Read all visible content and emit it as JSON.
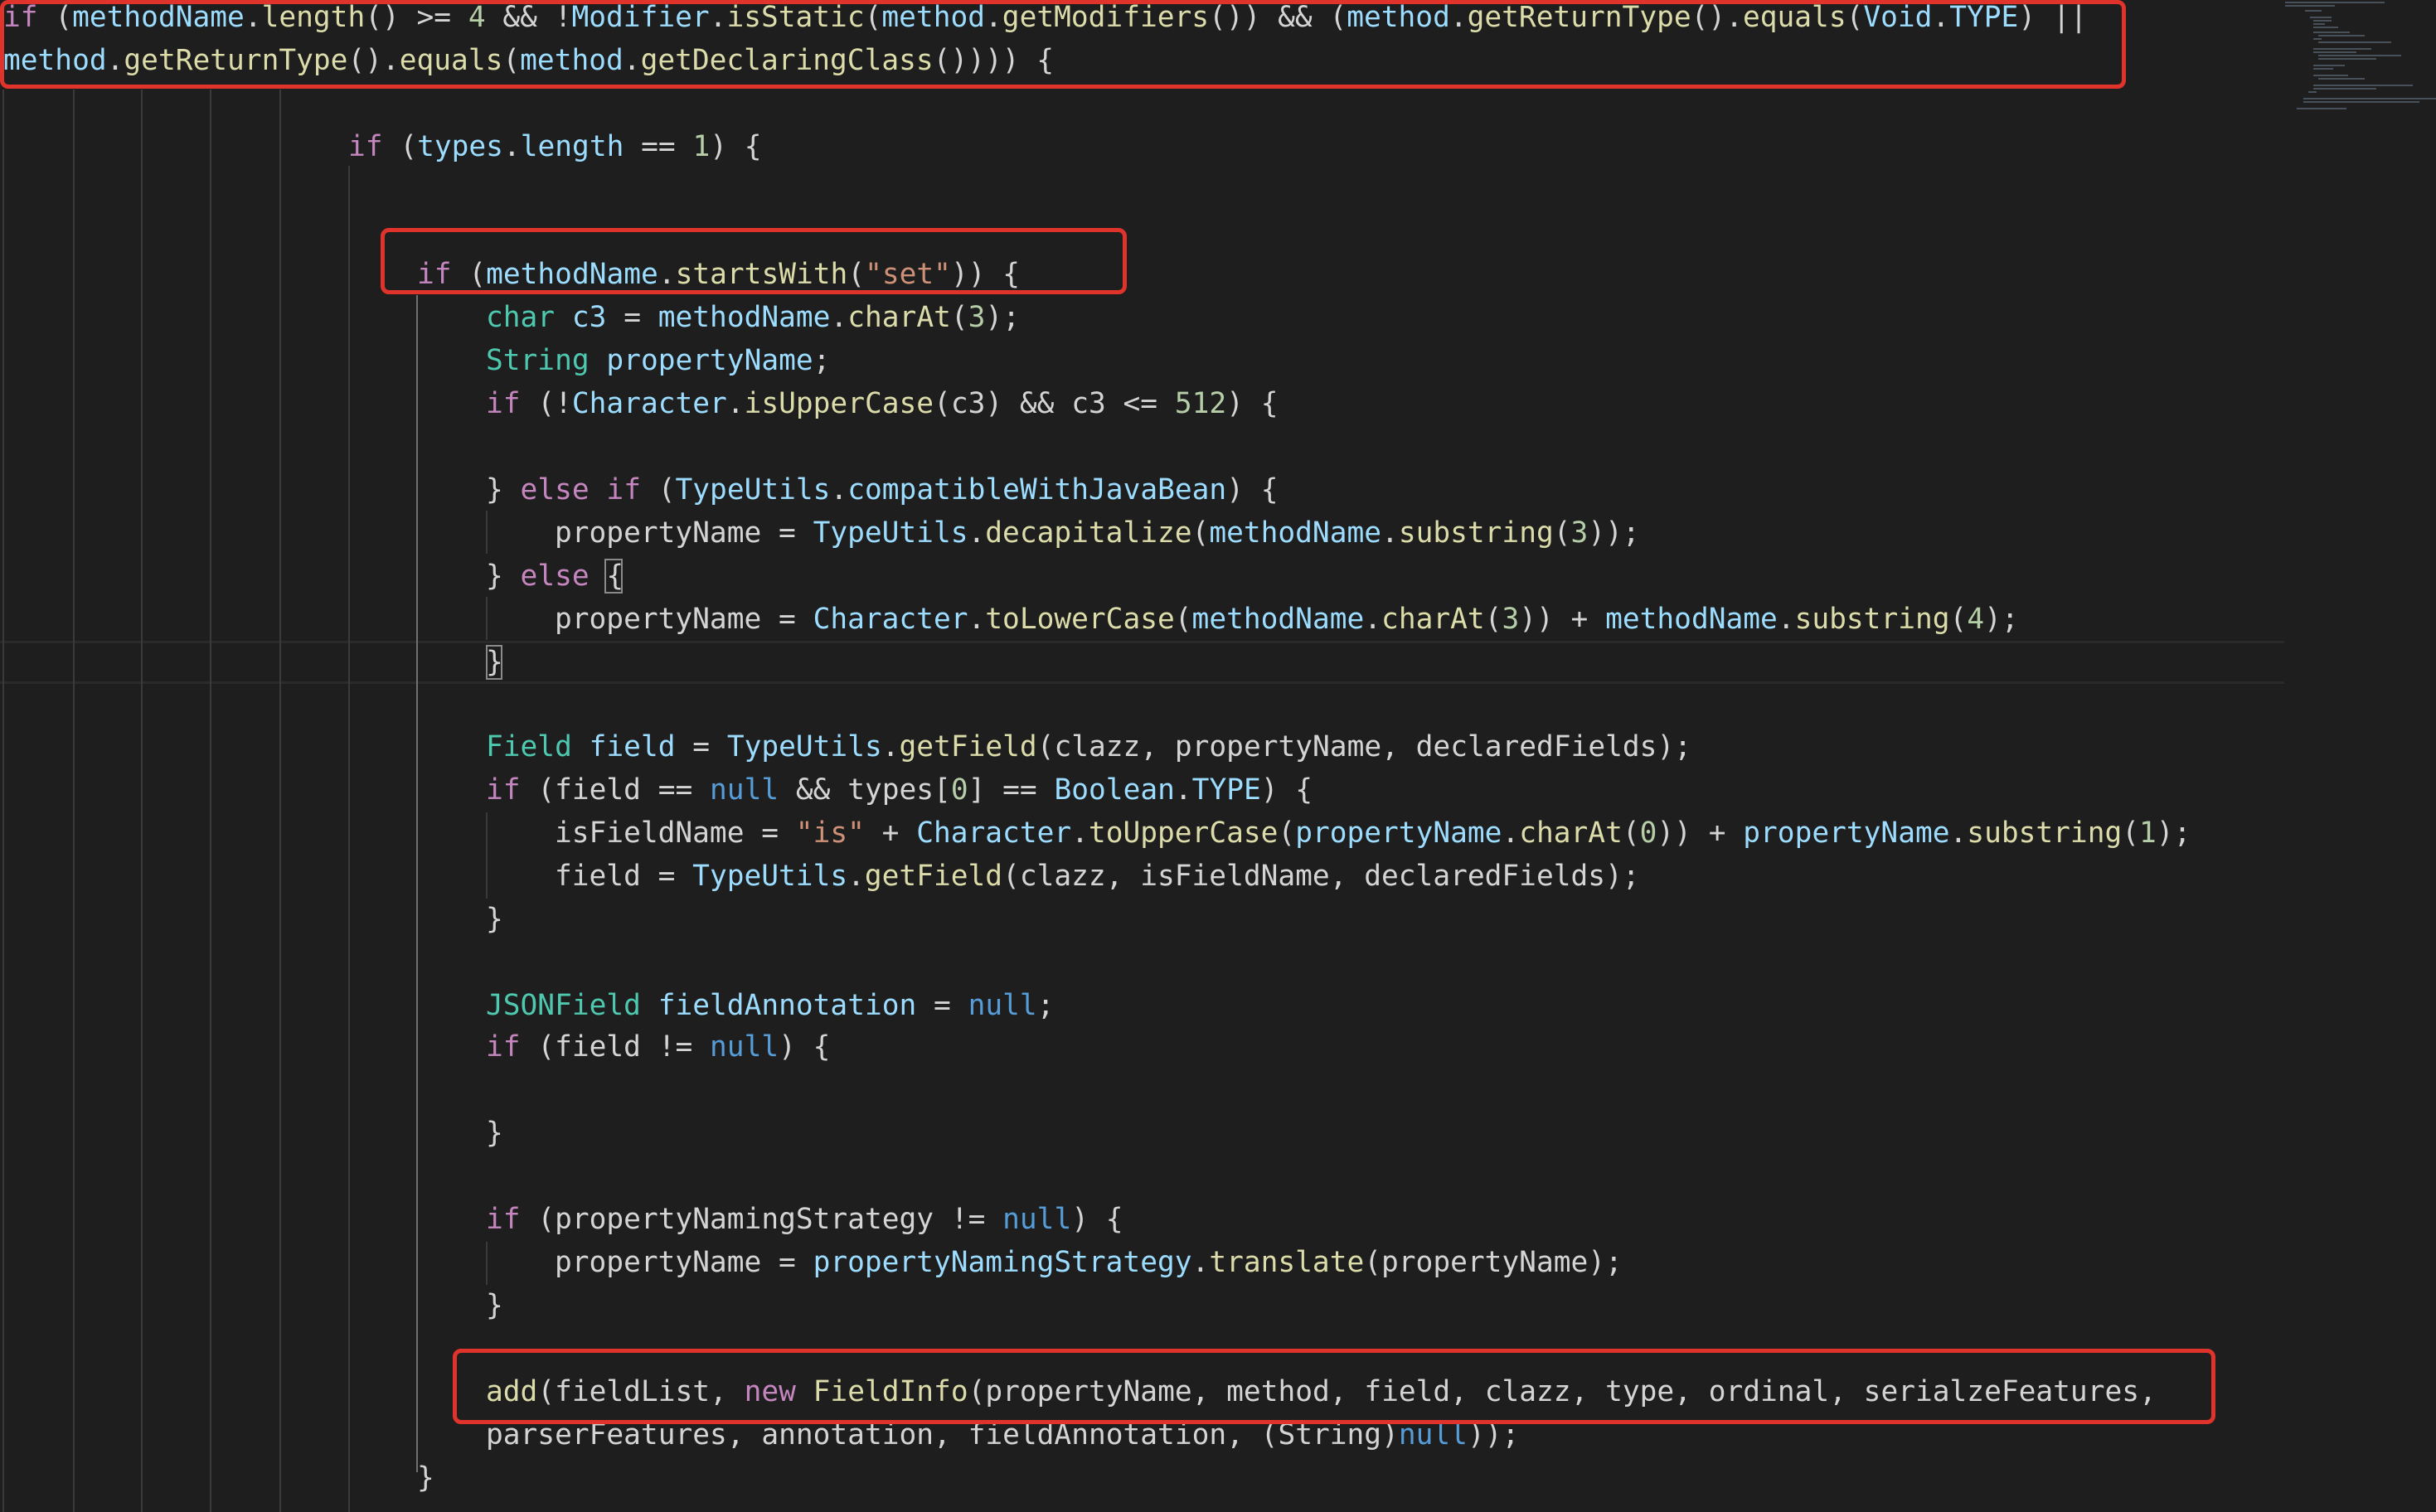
{
  "editor": {
    "lines": [
      {
        "tokens": [
          {
            "t": "if",
            "c": "kw"
          },
          {
            "t": " (",
            "c": "pl"
          },
          {
            "t": "methodName",
            "c": "vr"
          },
          {
            "t": ".",
            "c": "pl"
          },
          {
            "t": "length",
            "c": "fn"
          },
          {
            "t": "() >= ",
            "c": "pl"
          },
          {
            "t": "4",
            "c": "nu"
          },
          {
            "t": " && !",
            "c": "pl"
          },
          {
            "t": "Modifier",
            "c": "vr"
          },
          {
            "t": ".",
            "c": "pl"
          },
          {
            "t": "isStatic",
            "c": "fn"
          },
          {
            "t": "(",
            "c": "pl"
          },
          {
            "t": "method",
            "c": "vr"
          },
          {
            "t": ".",
            "c": "pl"
          },
          {
            "t": "getModifiers",
            "c": "fn"
          },
          {
            "t": "()) && (",
            "c": "pl"
          },
          {
            "t": "method",
            "c": "vr"
          },
          {
            "t": ".",
            "c": "pl"
          },
          {
            "t": "getReturnType",
            "c": "fn"
          },
          {
            "t": "().",
            "c": "pl"
          },
          {
            "t": "equals",
            "c": "fn"
          },
          {
            "t": "(",
            "c": "pl"
          },
          {
            "t": "Void",
            "c": "vr"
          },
          {
            "t": ".",
            "c": "pl"
          },
          {
            "t": "TYPE",
            "c": "vr"
          },
          {
            "t": ") ||",
            "c": "pl"
          }
        ]
      },
      {
        "tokens": [
          {
            "t": "method",
            "c": "vr"
          },
          {
            "t": ".",
            "c": "pl"
          },
          {
            "t": "getReturnType",
            "c": "fn"
          },
          {
            "t": "().",
            "c": "pl"
          },
          {
            "t": "equals",
            "c": "fn"
          },
          {
            "t": "(",
            "c": "pl"
          },
          {
            "t": "method",
            "c": "vr"
          },
          {
            "t": ".",
            "c": "pl"
          },
          {
            "t": "getDeclaringClass",
            "c": "fn"
          },
          {
            "t": "()))) {",
            "c": "pl"
          }
        ]
      },
      {
        "tokens": [
          {
            "t": "if",
            "c": "kw"
          },
          {
            "t": " (",
            "c": "pl"
          },
          {
            "t": "types",
            "c": "vr"
          },
          {
            "t": ".",
            "c": "pl"
          },
          {
            "t": "length",
            "c": "vr"
          },
          {
            "t": " == ",
            "c": "pl"
          },
          {
            "t": "1",
            "c": "nu"
          },
          {
            "t": ") {",
            "c": "pl"
          }
        ]
      },
      {
        "tokens": [
          {
            "t": "if",
            "c": "kw"
          },
          {
            "t": " (",
            "c": "pl"
          },
          {
            "t": "methodName",
            "c": "vr"
          },
          {
            "t": ".",
            "c": "pl"
          },
          {
            "t": "startsWith",
            "c": "fn"
          },
          {
            "t": "(",
            "c": "pl"
          },
          {
            "t": "\"set\"",
            "c": "st"
          },
          {
            "t": ")) {",
            "c": "pl"
          }
        ]
      },
      {
        "tokens": [
          {
            "t": "char",
            "c": "ty"
          },
          {
            "t": " ",
            "c": "pl"
          },
          {
            "t": "c3",
            "c": "vr"
          },
          {
            "t": " = ",
            "c": "pl"
          },
          {
            "t": "methodName",
            "c": "vr"
          },
          {
            "t": ".",
            "c": "pl"
          },
          {
            "t": "charAt",
            "c": "fn"
          },
          {
            "t": "(",
            "c": "pl"
          },
          {
            "t": "3",
            "c": "nu"
          },
          {
            "t": ");",
            "c": "pl"
          }
        ]
      },
      {
        "tokens": [
          {
            "t": "String",
            "c": "ty"
          },
          {
            "t": " ",
            "c": "pl"
          },
          {
            "t": "propertyName",
            "c": "vr"
          },
          {
            "t": ";",
            "c": "pl"
          }
        ]
      },
      {
        "tokens": [
          {
            "t": "if",
            "c": "kw"
          },
          {
            "t": " (!",
            "c": "pl"
          },
          {
            "t": "Character",
            "c": "vr"
          },
          {
            "t": ".",
            "c": "pl"
          },
          {
            "t": "isUpperCase",
            "c": "fn"
          },
          {
            "t": "(c3) && c3 <= ",
            "c": "pl"
          },
          {
            "t": "512",
            "c": "nu"
          },
          {
            "t": ") {",
            "c": "pl"
          }
        ]
      },
      {
        "tokens": [
          {
            "t": "} ",
            "c": "pl"
          },
          {
            "t": "else",
            "c": "kw"
          },
          {
            "t": " ",
            "c": "pl"
          },
          {
            "t": "if",
            "c": "kw"
          },
          {
            "t": " (",
            "c": "pl"
          },
          {
            "t": "TypeUtils",
            "c": "vr"
          },
          {
            "t": ".",
            "c": "pl"
          },
          {
            "t": "compatibleWithJavaBean",
            "c": "vr"
          },
          {
            "t": ") {",
            "c": "pl"
          }
        ]
      },
      {
        "tokens": [
          {
            "t": "propertyName = ",
            "c": "pl"
          },
          {
            "t": "TypeUtils",
            "c": "vr"
          },
          {
            "t": ".",
            "c": "pl"
          },
          {
            "t": "decapitalize",
            "c": "fn"
          },
          {
            "t": "(",
            "c": "pl"
          },
          {
            "t": "methodName",
            "c": "vr"
          },
          {
            "t": ".",
            "c": "pl"
          },
          {
            "t": "substring",
            "c": "fn"
          },
          {
            "t": "(",
            "c": "pl"
          },
          {
            "t": "3",
            "c": "nu"
          },
          {
            "t": "));",
            "c": "pl"
          }
        ]
      },
      {
        "tokens": [
          {
            "t": "} ",
            "c": "pl"
          },
          {
            "t": "else",
            "c": "kw"
          },
          {
            "t": " ",
            "c": "pl"
          },
          {
            "t": "{",
            "c": "pl"
          }
        ]
      },
      {
        "tokens": [
          {
            "t": "propertyName = ",
            "c": "pl"
          },
          {
            "t": "Character",
            "c": "vr"
          },
          {
            "t": ".",
            "c": "pl"
          },
          {
            "t": "toLowerCase",
            "c": "fn"
          },
          {
            "t": "(",
            "c": "pl"
          },
          {
            "t": "methodName",
            "c": "vr"
          },
          {
            "t": ".",
            "c": "pl"
          },
          {
            "t": "charAt",
            "c": "fn"
          },
          {
            "t": "(",
            "c": "pl"
          },
          {
            "t": "3",
            "c": "nu"
          },
          {
            "t": ")) + ",
            "c": "pl"
          },
          {
            "t": "methodName",
            "c": "vr"
          },
          {
            "t": ".",
            "c": "pl"
          },
          {
            "t": "substring",
            "c": "fn"
          },
          {
            "t": "(",
            "c": "pl"
          },
          {
            "t": "4",
            "c": "nu"
          },
          {
            "t": ");",
            "c": "pl"
          }
        ]
      },
      {
        "tokens": [
          {
            "t": "}",
            "c": "pl"
          }
        ]
      },
      {
        "tokens": [
          {
            "t": "Field",
            "c": "ty"
          },
          {
            "t": " ",
            "c": "pl"
          },
          {
            "t": "field",
            "c": "vr"
          },
          {
            "t": " = ",
            "c": "pl"
          },
          {
            "t": "TypeUtils",
            "c": "vr"
          },
          {
            "t": ".",
            "c": "pl"
          },
          {
            "t": "getField",
            "c": "fn"
          },
          {
            "t": "(clazz, propertyName, declaredFields);",
            "c": "pl"
          }
        ]
      },
      {
        "tokens": [
          {
            "t": "if",
            "c": "kw"
          },
          {
            "t": " (field == ",
            "c": "pl"
          },
          {
            "t": "null",
            "c": "lit"
          },
          {
            "t": " && types[",
            "c": "pl"
          },
          {
            "t": "0",
            "c": "nu"
          },
          {
            "t": "] == ",
            "c": "pl"
          },
          {
            "t": "Boolean",
            "c": "vr"
          },
          {
            "t": ".",
            "c": "pl"
          },
          {
            "t": "TYPE",
            "c": "vr"
          },
          {
            "t": ") {",
            "c": "pl"
          }
        ]
      },
      {
        "tokens": [
          {
            "t": "isFieldName = ",
            "c": "pl"
          },
          {
            "t": "\"is\"",
            "c": "st"
          },
          {
            "t": " + ",
            "c": "pl"
          },
          {
            "t": "Character",
            "c": "vr"
          },
          {
            "t": ".",
            "c": "pl"
          },
          {
            "t": "toUpperCase",
            "c": "fn"
          },
          {
            "t": "(",
            "c": "pl"
          },
          {
            "t": "propertyName",
            "c": "vr"
          },
          {
            "t": ".",
            "c": "pl"
          },
          {
            "t": "charAt",
            "c": "fn"
          },
          {
            "t": "(",
            "c": "pl"
          },
          {
            "t": "0",
            "c": "nu"
          },
          {
            "t": ")) + ",
            "c": "pl"
          },
          {
            "t": "propertyName",
            "c": "vr"
          },
          {
            "t": ".",
            "c": "pl"
          },
          {
            "t": "substring",
            "c": "fn"
          },
          {
            "t": "(",
            "c": "pl"
          },
          {
            "t": "1",
            "c": "nu"
          },
          {
            "t": ");",
            "c": "pl"
          }
        ]
      },
      {
        "tokens": [
          {
            "t": "field = ",
            "c": "pl"
          },
          {
            "t": "TypeUtils",
            "c": "vr"
          },
          {
            "t": ".",
            "c": "pl"
          },
          {
            "t": "getField",
            "c": "fn"
          },
          {
            "t": "(clazz, isFieldName, declaredFields);",
            "c": "pl"
          }
        ]
      },
      {
        "tokens": [
          {
            "t": "}",
            "c": "pl"
          }
        ]
      },
      {
        "tokens": [
          {
            "t": "JSONField",
            "c": "ty"
          },
          {
            "t": " ",
            "c": "pl"
          },
          {
            "t": "fieldAnnotation",
            "c": "vr"
          },
          {
            "t": " = ",
            "c": "pl"
          },
          {
            "t": "null",
            "c": "lit"
          },
          {
            "t": ";",
            "c": "pl"
          }
        ]
      },
      {
        "tokens": [
          {
            "t": "if",
            "c": "kw"
          },
          {
            "t": " (field != ",
            "c": "pl"
          },
          {
            "t": "null",
            "c": "lit"
          },
          {
            "t": ") {",
            "c": "pl"
          }
        ]
      },
      {
        "tokens": [
          {
            "t": "}",
            "c": "pl"
          }
        ]
      },
      {
        "tokens": [
          {
            "t": "if",
            "c": "kw"
          },
          {
            "t": " (propertyNamingStrategy != ",
            "c": "pl"
          },
          {
            "t": "null",
            "c": "lit"
          },
          {
            "t": ") {",
            "c": "pl"
          }
        ]
      },
      {
        "tokens": [
          {
            "t": "propertyName = ",
            "c": "pl"
          },
          {
            "t": "propertyNamingStrategy",
            "c": "vr"
          },
          {
            "t": ".",
            "c": "pl"
          },
          {
            "t": "translate",
            "c": "fn"
          },
          {
            "t": "(propertyName);",
            "c": "pl"
          }
        ]
      },
      {
        "tokens": [
          {
            "t": "}",
            "c": "pl"
          }
        ]
      },
      {
        "tokens": [
          {
            "t": "add",
            "c": "fn"
          },
          {
            "t": "(fieldList, ",
            "c": "pl"
          },
          {
            "t": "new",
            "c": "kw"
          },
          {
            "t": " ",
            "c": "pl"
          },
          {
            "t": "FieldInfo",
            "c": "fn"
          },
          {
            "t": "(propertyName, method, field, clazz, type, ordinal, serialzeFeatures,",
            "c": "pl"
          }
        ]
      },
      {
        "tokens": [
          {
            "t": "parserFeatures, annotation, fieldAnnotation, (String)",
            "c": "pl"
          },
          {
            "t": "null",
            "c": "lit"
          },
          {
            "t": "));",
            "c": "pl"
          }
        ]
      },
      {
        "tokens": [
          {
            "t": "}",
            "c": "pl"
          }
        ]
      }
    ]
  },
  "colors": {
    "background": "#1e1e1e",
    "keyword": "#c586c0",
    "type": "#4ec9b0",
    "function": "#dcdcaa",
    "variable": "#9cdcfe",
    "number": "#b5cea8",
    "string": "#ce9178",
    "literal": "#569cd6",
    "plain": "#d4d4d4",
    "annotation_box": "#e0332b"
  }
}
